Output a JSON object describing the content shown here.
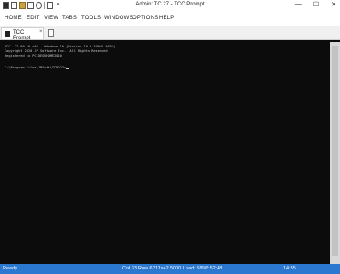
{
  "window": {
    "title": "Admin: TC 27 - TCC Prompt",
    "controls": {
      "minimize": "—",
      "maximize": "☐",
      "close": "✕"
    }
  },
  "menubar": {
    "items": [
      "HOME",
      "EDIT",
      "VIEW",
      "TABS",
      "TOOLS",
      "WINDOWS",
      "OPTIONS",
      "HELP"
    ]
  },
  "tabs": {
    "active_label": "TCC Prompt",
    "close_glyph": "×"
  },
  "console": {
    "lines": [
      "TCC  27.00.16 x64   Windows 10 [Version 10.0.19045.4651]",
      "Copyright 2020 JP Software Inc.  All Rights Reserved",
      "Registered to PC-DESKHOME2010",
      "C:\\Program Files\\JPSoft\\TCMD27>"
    ]
  },
  "statusbar": {
    "ready": "Ready",
    "col": "Col 33",
    "row": "Row 6",
    "size": "211x42",
    "buffer": "5000",
    "load": "Load: 58%",
    "time": "2:52:48",
    "extra": "14:55"
  },
  "colors": {
    "console_bg": "#0c0c0c",
    "console_text": "#c8c8c8",
    "statusbar_bg": "#2b78d0"
  }
}
